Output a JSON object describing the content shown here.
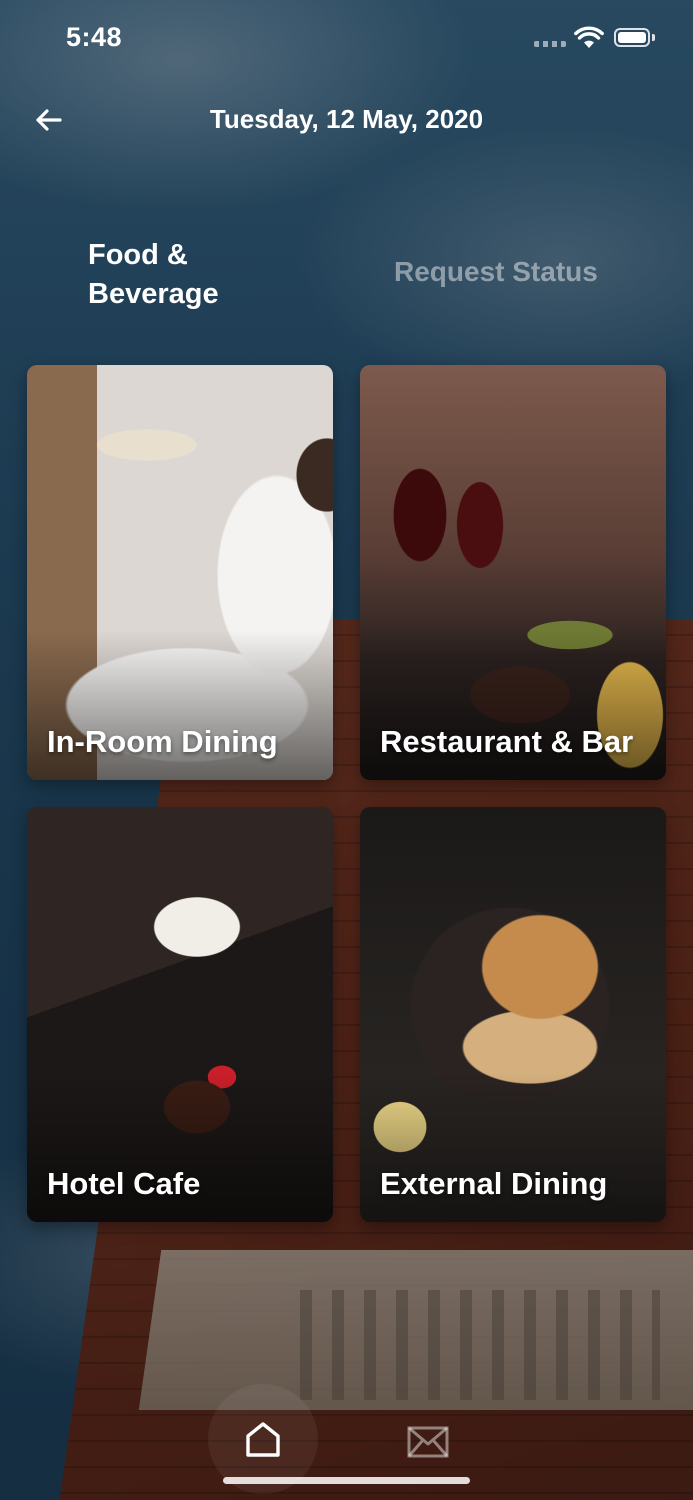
{
  "status_bar": {
    "time": "5:48"
  },
  "header": {
    "title": "Tuesday, 12 May, 2020",
    "back_icon": "arrow-left-icon"
  },
  "tabs": [
    {
      "label": "Food & Beverage",
      "active": true
    },
    {
      "label": "Request Status",
      "active": false
    }
  ],
  "cards": [
    {
      "label": "In-Room Dining"
    },
    {
      "label": "Restaurant & Bar"
    },
    {
      "label": "Hotel Cafe"
    },
    {
      "label": "External Dining"
    }
  ],
  "tabbar": {
    "items": [
      {
        "icon": "home-icon",
        "active": true
      },
      {
        "icon": "mail-icon",
        "active": false
      }
    ]
  },
  "colors": {
    "text_primary": "#ffffff",
    "text_inactive": "rgba(255,255,255,0.45)",
    "background_sky": "#2a5677"
  }
}
